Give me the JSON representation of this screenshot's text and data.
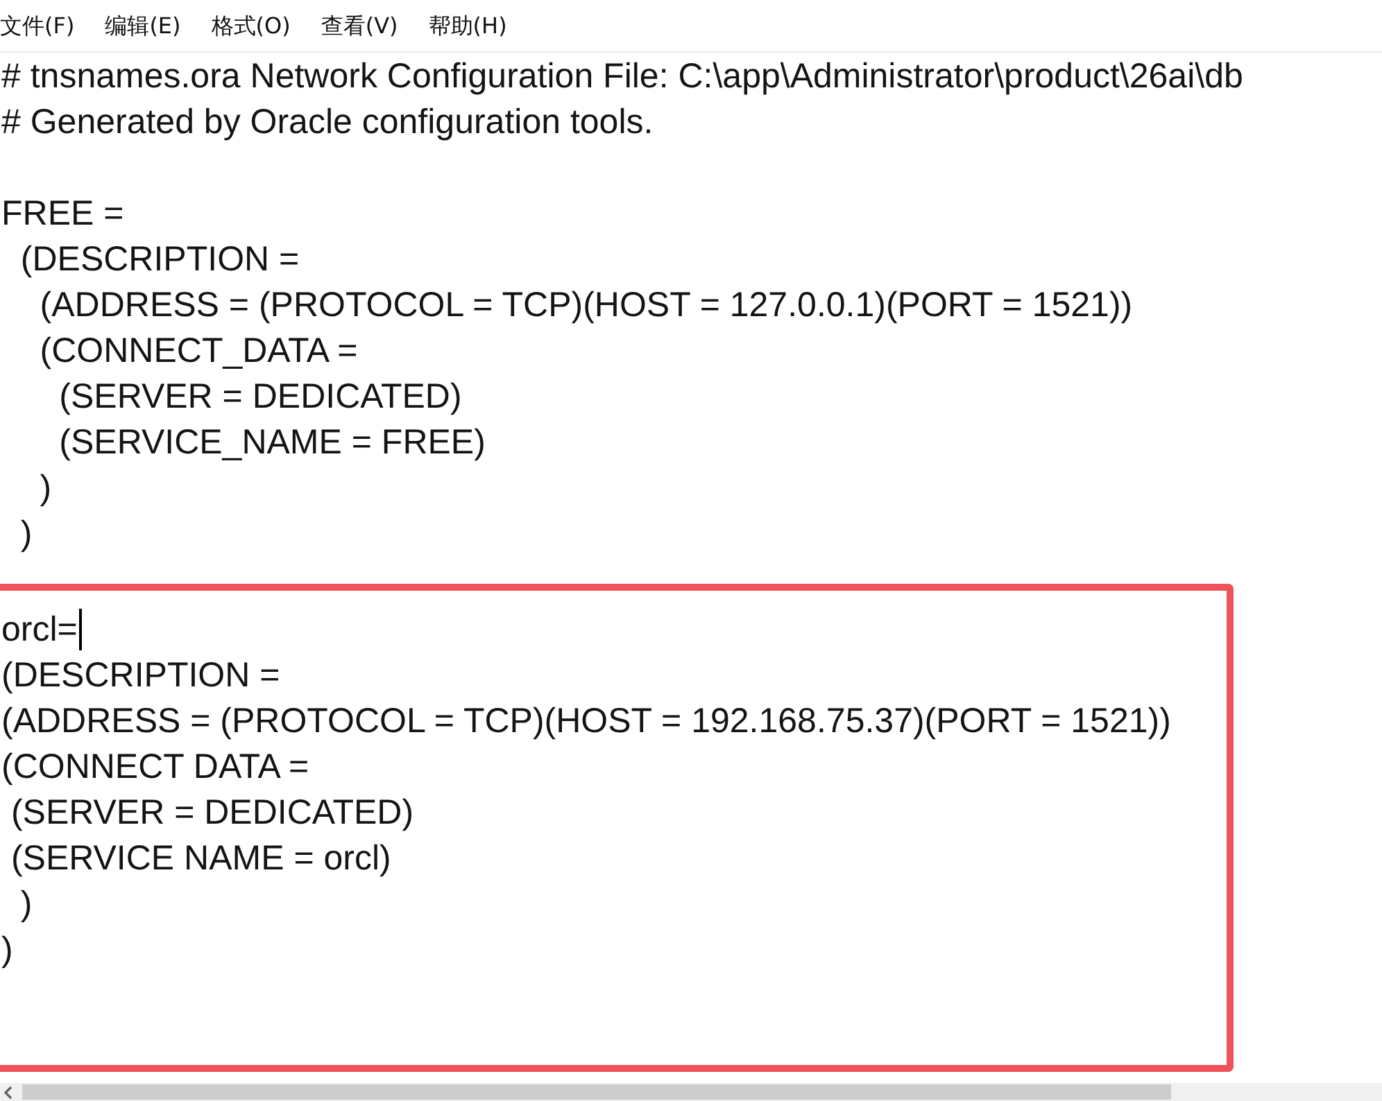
{
  "menu": [
    {
      "label": "文件(F)"
    },
    {
      "label": "编辑(E)"
    },
    {
      "label": "格式(O)"
    },
    {
      "label": "查看(V)"
    },
    {
      "label": "帮助(H)"
    }
  ],
  "editor": {
    "blocks": [
      {
        "highlighted": false,
        "lines": [
          {
            "text": "# tnsnames.ora Network Configuration File: C:\\app\\Administrator\\product\\26ai\\db",
            "caret": false
          },
          {
            "text": "# Generated by Oracle configuration tools.",
            "caret": false
          }
        ]
      },
      {
        "highlighted": false,
        "lines": [
          {
            "text": "FREE =",
            "caret": false
          },
          {
            "text": "  (DESCRIPTION =",
            "caret": false
          },
          {
            "text": "    (ADDRESS = (PROTOCOL = TCP)(HOST = 127.0.0.1)(PORT = 1521))",
            "caret": false
          },
          {
            "text": "    (CONNECT_DATA =",
            "caret": false
          },
          {
            "text": "      (SERVER = DEDICATED)",
            "caret": false
          },
          {
            "text": "      (SERVICE_NAME = FREE)",
            "caret": false
          },
          {
            "text": "    )",
            "caret": false
          },
          {
            "text": "  )",
            "caret": false
          }
        ]
      },
      {
        "highlighted": true,
        "lines": [
          {
            "text": "orcl=",
            "caret": true
          },
          {
            "text": "(DESCRIPTION =",
            "caret": false
          },
          {
            "text": "(ADDRESS = (PROTOCOL = TCP)(HOST = 192.168.75.37)(PORT = 1521))",
            "caret": false
          },
          {
            "text": "(CONNECT DATA =",
            "caret": false
          },
          {
            "text": " (SERVER = DEDICATED)",
            "caret": false
          },
          {
            "text": " (SERVICE NAME = orcl)",
            "caret": false
          },
          {
            "text": "  )",
            "caret": false
          },
          {
            "text": ")",
            "caret": false
          }
        ]
      }
    ]
  }
}
